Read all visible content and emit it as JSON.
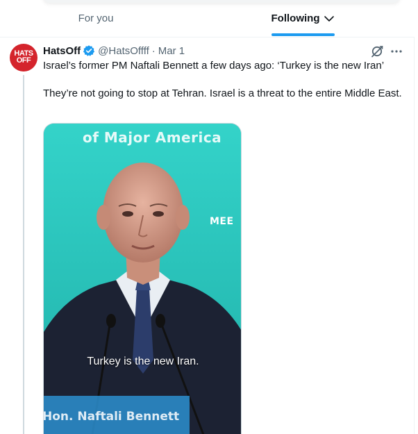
{
  "header": {
    "tabs": [
      {
        "label": "For you",
        "active": false
      },
      {
        "label": "Following",
        "active": true
      }
    ],
    "accent_color": "#1d9bf0"
  },
  "tweet": {
    "avatar": {
      "line1": "HATS",
      "line2": "OFF",
      "bg_color": "#d4242c"
    },
    "display_name": "HatsOff",
    "verified": true,
    "handle": "@HatsOffff",
    "separator": "·",
    "date": "Mar 1",
    "text_line1": "Israel’s former PM Naftali Bennett a few days ago: ‘Turkey is the new Iran’",
    "text_line2": "They’re not going to stop at Tehran. Israel is a threat to the entire Middle East.",
    "icons": [
      "grok-icon",
      "more-icon"
    ],
    "media": {
      "banner_text": "of Major America",
      "logo_text": "MEE",
      "caption": "Turkey is the new Iran.",
      "lower_third": "Hon. Naftali Bennett",
      "bg_color": "#2fc8c0"
    }
  }
}
